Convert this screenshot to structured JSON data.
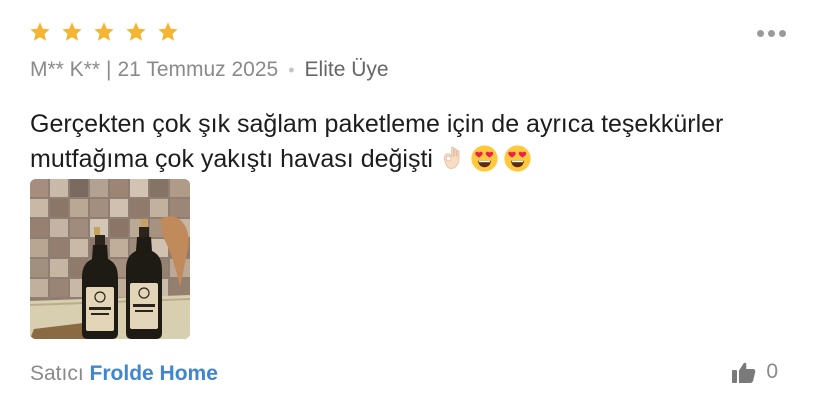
{
  "review": {
    "rating": 5,
    "rating_max": 5,
    "author": "M** K**",
    "separator": "|",
    "date": "21 Temmuz 2025",
    "dot": "•",
    "badge": "Elite Üye",
    "text": "Gerçekten çok şık sağlam paketleme için de ayrıca teşekkürler mutfağıma çok yakıştı havası değişti",
    "emojis": [
      "ok-hand-icon",
      "heart-eyes-icon",
      "heart-eyes-icon"
    ]
  },
  "seller": {
    "prefix": "Satıcı",
    "name": "Frolde Home"
  },
  "likes": {
    "count": "0"
  },
  "colors": {
    "star": "#F6B431",
    "link": "#3F86CF",
    "muted": "#8A8A8A"
  }
}
